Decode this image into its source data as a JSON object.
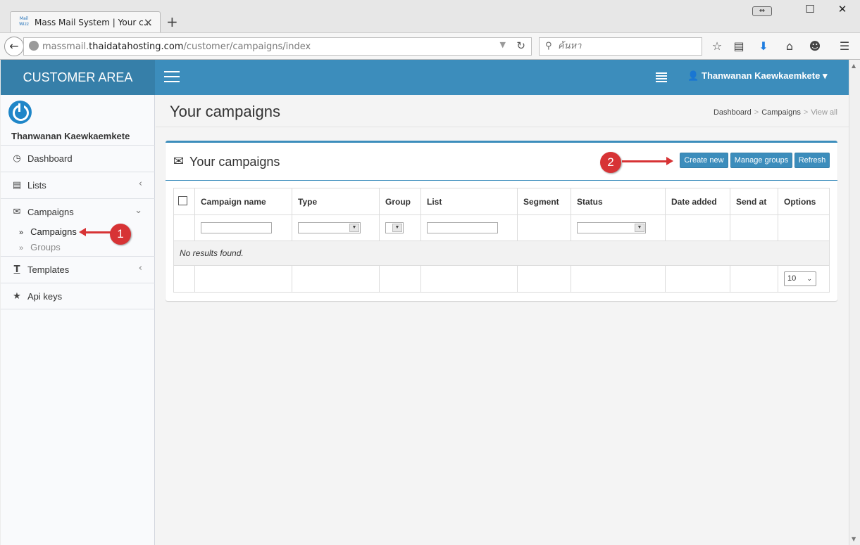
{
  "browser": {
    "tab_title": "Mass Mail System | Your c...",
    "favicon_text": "Mail Wizz",
    "url_host_prefix": "massmail.",
    "url_host": "thaidatahosting.com",
    "url_path": "/customer/campaigns/index",
    "search_placeholder": "ค้นหา",
    "icons": [
      "back-icon",
      "globe-icon",
      "reload-icon",
      "search-icon",
      "bookmark-star-icon",
      "reading-list-icon",
      "download-icon",
      "home-icon",
      "emoji-icon",
      "menu-icon"
    ]
  },
  "app": {
    "logo": "CUSTOMER AREA",
    "user_name": "Thanwanan Kaewkaemkete",
    "accent_color": "#3c8dbc"
  },
  "sidebar": {
    "user_name": "Thanwanan Kaewkaemkete",
    "items": [
      {
        "label": "Dashboard"
      },
      {
        "label": "Lists"
      },
      {
        "label": "Campaigns"
      },
      {
        "label": "Templates"
      },
      {
        "label": "Api keys"
      }
    ],
    "campaign_subitems": [
      {
        "label": "Campaigns"
      },
      {
        "label": "Groups"
      }
    ]
  },
  "page": {
    "title": "Your campaigns",
    "breadcrumb": [
      "Dashboard",
      "Campaigns",
      "View all"
    ]
  },
  "box": {
    "title": "Your campaigns",
    "buttons": {
      "create_new": "Create new",
      "manage_groups": "Manage groups",
      "refresh": "Refresh"
    }
  },
  "table": {
    "columns": [
      "Campaign name",
      "Type",
      "Group",
      "List",
      "Segment",
      "Status",
      "Date added",
      "Send at",
      "Options"
    ],
    "empty_text": "No results found.",
    "page_size": "10"
  },
  "annotations": [
    "1",
    "2"
  ]
}
